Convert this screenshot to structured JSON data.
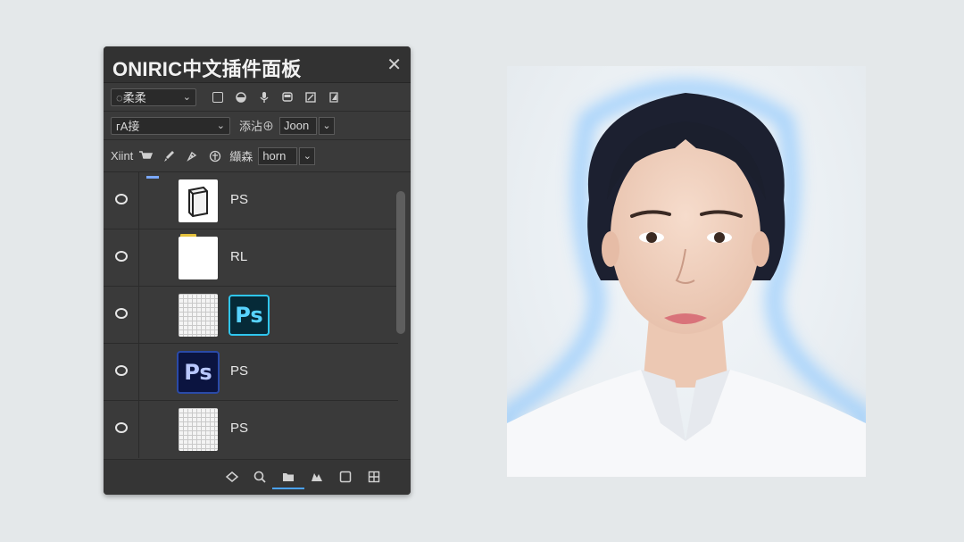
{
  "panel": {
    "title": "ONIRIC中文插件面板",
    "close_glyph": "✕",
    "row1": {
      "select_value": "◌柔柔",
      "caret": "⌄"
    },
    "row2": {
      "select_value": "ᴦA接",
      "caret": "⌄",
      "label": "添沾⊕",
      "mini_value": "Joon",
      "mini_caret": "⌄"
    },
    "row3": {
      "label1": "Xiint",
      "label2": "纈森",
      "mini_value": "horn",
      "mini_caret": "⌄"
    }
  },
  "layers": [
    {
      "name": "PS",
      "thumb": "document-icon"
    },
    {
      "name": "RL",
      "thumb": "folder"
    },
    {
      "name": "",
      "thumb": "grid",
      "badge": "Ps"
    },
    {
      "name": "PS",
      "thumb": "ps-dark",
      "badge": "Ps"
    },
    {
      "name": "PS",
      "thumb": "grid"
    }
  ],
  "bottom_icons": [
    "fill-icon",
    "search-icon",
    "folder-icon",
    "mask-icon",
    "square-icon",
    "grid-icon"
  ],
  "colors": {
    "panel_bg": "#3a3a3a",
    "ps_blue": "#31a8ff",
    "accent_underline": "#4aa3ff",
    "folder_yellow": "#e5c23d"
  }
}
